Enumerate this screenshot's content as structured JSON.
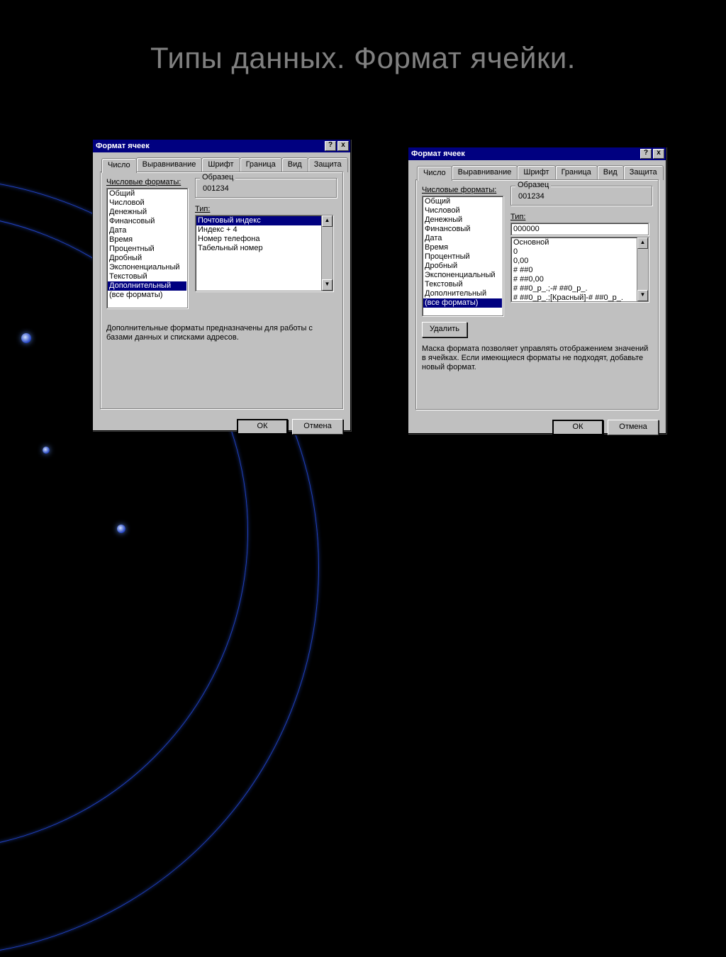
{
  "slide": {
    "title": "Типы данных. Формат ячейки."
  },
  "dlg": {
    "title": "Формат ячеек",
    "help": "?",
    "close": "x",
    "tabs": [
      "Число",
      "Выравнивание",
      "Шрифт",
      "Граница",
      "Вид",
      "Защита"
    ],
    "formats_label": "Числовые форматы:",
    "sample_group": "Образец",
    "type_label": "Тип:",
    "ok": "ОК",
    "cancel": "Отмена",
    "delete": "Удалить"
  },
  "left": {
    "formats": [
      "Общий",
      "Числовой",
      "Денежный",
      "Финансовый",
      "Дата",
      "Время",
      "Процентный",
      "Дробный",
      "Экспоненциальный",
      "Текстовый",
      "Дополнительный",
      "(все форматы)"
    ],
    "selected": 10,
    "sample": "001234",
    "types": [
      "Почтовый индекс",
      "Индекс + 4",
      "Номер телефона",
      "Табельный номер"
    ],
    "type_selected": 0,
    "desc": "Дополнительные форматы предназначены для работы с базами данных и списками адресов."
  },
  "right": {
    "formats": [
      "Общий",
      "Числовой",
      "Денежный",
      "Финансовый",
      "Дата",
      "Время",
      "Процентный",
      "Дробный",
      "Экспоненциальный",
      "Текстовый",
      "Дополнительный",
      "(все форматы)"
    ],
    "selected": 11,
    "sample": "001234",
    "type_value": "000000",
    "types": [
      "Основной",
      "0",
      "0,00",
      "# ##0",
      "# ##0,00",
      "# ##0_р_.;-# ##0_р_.",
      "# ##0_р_.;[Красный]-# ##0_р_."
    ],
    "desc": "Маска формата позволяет управлять отображением значений в ячейках. Если имеющиеся форматы не подходят, добавьте новый формат."
  }
}
